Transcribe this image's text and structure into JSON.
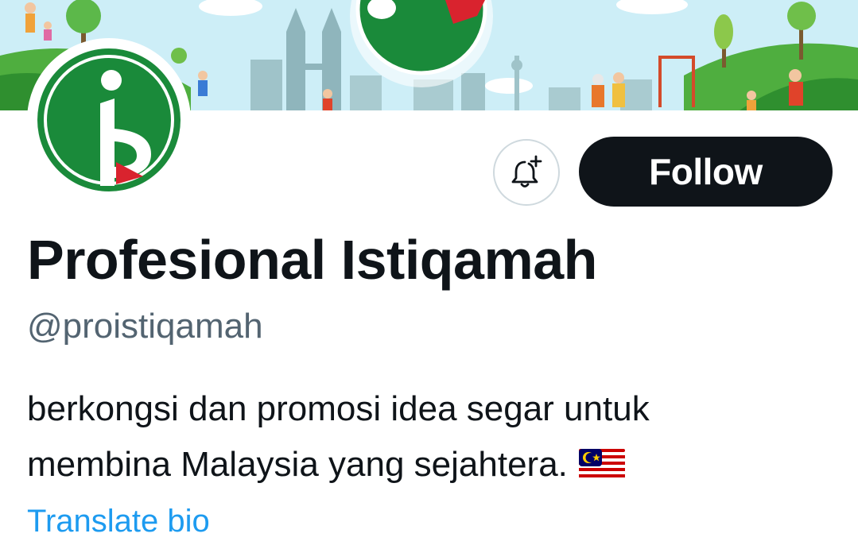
{
  "banner": {
    "alt_icon": "cityscape-banner"
  },
  "profile": {
    "display_name": "Profesional Istiqamah",
    "handle": "@proistiqamah",
    "bio_lines": [
      "berkongsi dan promosi idea segar untuk",
      "membina Malaysia yang sejahtera."
    ],
    "bio_emoji": "malaysia-flag-icon",
    "translate_label": "Translate bio"
  },
  "actions": {
    "notify_icon": "bell-plus-icon",
    "follow_label": "Follow"
  },
  "colors": {
    "text_primary": "#0f1419",
    "text_secondary": "#536471",
    "link": "#1d9bf0",
    "button_bg": "#0f1419",
    "logo_green": "#1a8a3a",
    "logo_red": "#d9232e"
  }
}
